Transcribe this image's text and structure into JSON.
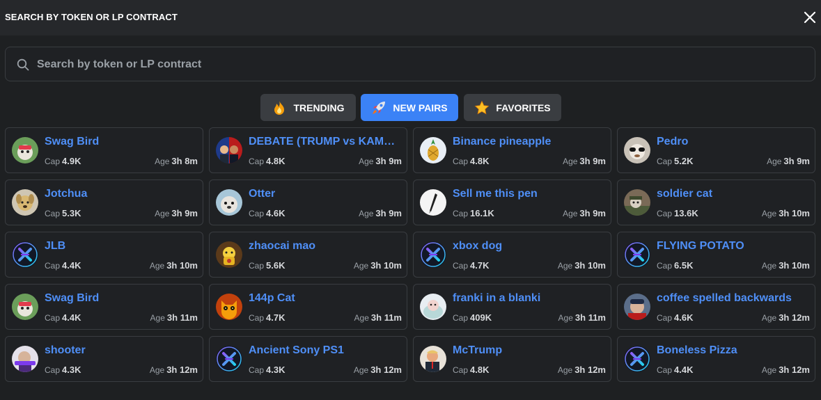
{
  "header": {
    "title": "SEARCH BY TOKEN OR LP CONTRACT"
  },
  "search": {
    "placeholder": "Search by token or LP contract",
    "value": ""
  },
  "tabs": [
    {
      "label": "TRENDING",
      "icon": "fire-icon",
      "active": false
    },
    {
      "label": "NEW PAIRS",
      "icon": "rocket-icon",
      "active": true
    },
    {
      "label": "FAVORITES",
      "icon": "star-icon",
      "active": false
    }
  ],
  "labels": {
    "cap": "Cap",
    "age": "Age"
  },
  "colors": {
    "accent": "#3b82f6",
    "name": "#4f8ff7",
    "background": "#1e2022"
  },
  "tokens": [
    {
      "name": "Swag Bird",
      "cap": "4.9K",
      "age": "3h 8m",
      "icon": "swag-bird-avatar"
    },
    {
      "name": "DEBATE (TRUMP vs KAMALA)",
      "cap": "4.8K",
      "age": "3h 9m",
      "icon": "debate-avatar"
    },
    {
      "name": "Binance pineapple",
      "cap": "4.8K",
      "age": "3h 9m",
      "icon": "pineapple-avatar"
    },
    {
      "name": "Pedro",
      "cap": "5.2K",
      "age": "3h 9m",
      "icon": "pedro-avatar"
    },
    {
      "name": "Jotchua",
      "cap": "5.3K",
      "age": "3h 9m",
      "icon": "dog-avatar"
    },
    {
      "name": "Otter",
      "cap": "4.6K",
      "age": "3h 9m",
      "icon": "otter-avatar"
    },
    {
      "name": "Sell me this pen",
      "cap": "16.1K",
      "age": "3h 9m",
      "icon": "pen-avatar"
    },
    {
      "name": "soldier cat",
      "cap": "13.6K",
      "age": "3h 10m",
      "icon": "soldier-cat-avatar"
    },
    {
      "name": "JLB",
      "cap": "4.4K",
      "age": "3h 10m",
      "icon": "x-logo-avatar"
    },
    {
      "name": "zhaocai mao",
      "cap": "5.6K",
      "age": "3h 10m",
      "icon": "lucky-cat-avatar"
    },
    {
      "name": "xbox dog",
      "cap": "4.7K",
      "age": "3h 10m",
      "icon": "x-logo-avatar"
    },
    {
      "name": "FLYING POTATO",
      "cap": "6.5K",
      "age": "3h 10m",
      "icon": "x-logo-avatar"
    },
    {
      "name": "Swag Bird",
      "cap": "4.4K",
      "age": "3h 11m",
      "icon": "swag-bird-avatar"
    },
    {
      "name": "144p Cat",
      "cap": "4.7K",
      "age": "3h 11m",
      "icon": "cat-avatar"
    },
    {
      "name": "franki in a blanki",
      "cap": "409K",
      "age": "3h 11m",
      "icon": "franki-avatar"
    },
    {
      "name": "coffee spelled backwards",
      "cap": "4.6K",
      "age": "3h 12m",
      "icon": "coffee-avatar"
    },
    {
      "name": "shooter",
      "cap": "4.3K",
      "age": "3h 12m",
      "icon": "shooter-avatar"
    },
    {
      "name": "Ancient Sony PS1",
      "cap": "4.3K",
      "age": "3h 12m",
      "icon": "x-logo-avatar"
    },
    {
      "name": "McTrump",
      "cap": "4.8K",
      "age": "3h 12m",
      "icon": "mctrump-avatar"
    },
    {
      "name": "Boneless Pizza",
      "cap": "4.4K",
      "age": "3h 12m",
      "icon": "x-logo-avatar"
    }
  ]
}
